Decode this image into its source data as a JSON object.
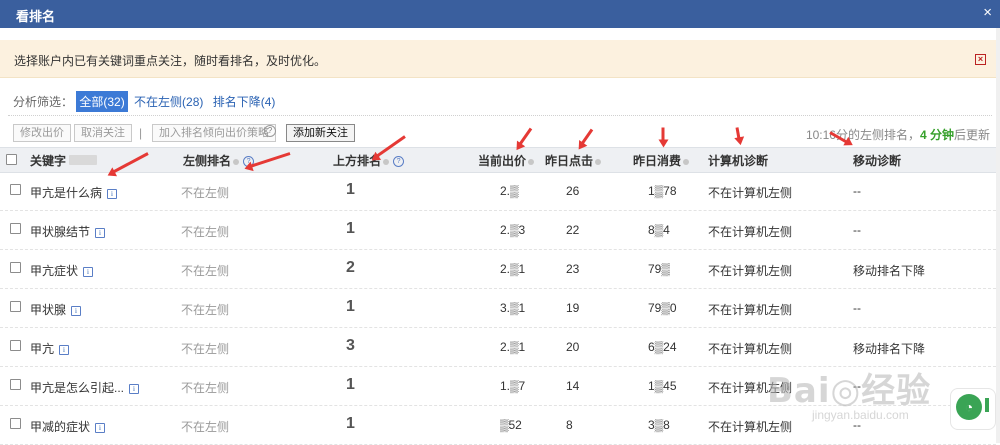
{
  "dialog": {
    "title": "看排名",
    "close": "×"
  },
  "notice": {
    "message": "选择账户内已有关键词重点关注，随时看排名，及时优化。",
    "close": "×"
  },
  "filter": {
    "label": "分析筛选：",
    "options": [
      {
        "label": "全部(32)",
        "active": true
      },
      {
        "label": "不在左侧(28)",
        "active": false
      },
      {
        "label": "排名下降(4)",
        "active": false
      }
    ]
  },
  "toolbar": {
    "edit_bid": "修改出价",
    "unfollow": "取消关注",
    "sep": "|",
    "add_strategy": "加入排名倾向出价策略",
    "help": "?",
    "add_follow": "添加新关注"
  },
  "status": {
    "prefix": "10:16分的左侧排名，",
    "minutes": "4 分钟",
    "suffix": "后更新"
  },
  "columns": {
    "keyword": "关键字",
    "left_rank": "左侧排名",
    "top_rank": "上方排名",
    "bid": "当前出价",
    "clicks": "昨日点击",
    "cost": "昨日消费",
    "pc_diag": "计算机诊断",
    "mobile_diag": "移动诊断"
  },
  "rows": [
    {
      "keyword": "甲亢是什么病",
      "left_rank": "不在左侧",
      "top_rank": "1",
      "bid": "2.▒",
      "clicks": "26",
      "cost": "1▒78",
      "pc_diag": "不在计算机左侧",
      "mobile_diag": "--"
    },
    {
      "keyword": "甲状腺结节",
      "left_rank": "不在左侧",
      "top_rank": "1",
      "bid": "2.▒3",
      "clicks": "22",
      "cost": "8▒4",
      "pc_diag": "不在计算机左侧",
      "mobile_diag": "--"
    },
    {
      "keyword": "甲亢症状",
      "left_rank": "不在左侧",
      "top_rank": "2",
      "bid": "2.▒1",
      "clicks": "23",
      "cost": "79▒",
      "pc_diag": "不在计算机左侧",
      "mobile_diag": "移动排名下降"
    },
    {
      "keyword": "甲状腺",
      "left_rank": "不在左侧",
      "top_rank": "1",
      "bid": "3.▒1",
      "clicks": "19",
      "cost": "79▒0",
      "pc_diag": "不在计算机左侧",
      "mobile_diag": "--"
    },
    {
      "keyword": "甲亢",
      "left_rank": "不在左侧",
      "top_rank": "3",
      "bid": "2.▒1",
      "clicks": "20",
      "cost": "6▒24",
      "pc_diag": "不在计算机左侧",
      "mobile_diag": "移动排名下降"
    },
    {
      "keyword": "甲亢是怎么引起...",
      "left_rank": "不在左侧",
      "top_rank": "1",
      "bid": "1.▒7",
      "clicks": "14",
      "cost": "1▒45",
      "pc_diag": "不在计算机左侧",
      "mobile_diag": "--"
    },
    {
      "keyword": "甲减的症状",
      "left_rank": "不在左侧",
      "top_rank": "1",
      "bid": "▒52",
      "clicks": "8",
      "cost": "3▒8",
      "pc_diag": "不在计算机左侧",
      "mobile_diag": "--"
    }
  ],
  "watermark": {
    "brand": "Bai◎经验",
    "url": "jingyan.baidu.com"
  },
  "colors": {
    "titlebar": "#3a5f9e",
    "notice_bg": "#fcf1df",
    "active_filter": "#3c7ad6",
    "minutes": "#36a02b",
    "annotation_arrow": "#e53935"
  }
}
